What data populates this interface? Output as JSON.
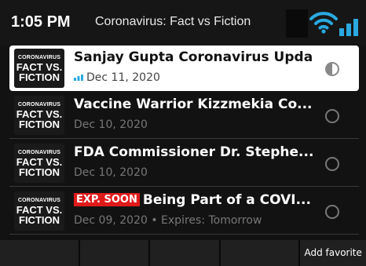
{
  "status_bar": {
    "time": "1:05 PM",
    "title": "Coronavirus: Fact vs Fiction",
    "icons": [
      "wifi-icon",
      "signal-icon"
    ]
  },
  "thumbnail": {
    "small": "CORONAVIRUS",
    "line1": "FACT VS.",
    "line2": "FICTION"
  },
  "episodes": [
    {
      "title": "Sanjay Gupta Coronavirus Upda",
      "date": "Dec 11, 2020",
      "status": "partially-played",
      "selected": true
    },
    {
      "title": "Vaccine Warrior Kizzmekia Co...",
      "date": "Dec 10, 2020",
      "status": "unplayed"
    },
    {
      "title": "FDA Commissioner Dr. Stephe...",
      "date": "Dec 10, 2020",
      "status": "unplayed"
    },
    {
      "title": "Being Part of a COVI...",
      "date": "Dec 09, 2020",
      "badge": "EXP. SOON",
      "expires": "• Expires: Tomorrow",
      "status": "unplayed"
    }
  ],
  "softkeys": [
    "",
    "",
    "",
    "",
    "Add favorite"
  ],
  "colors": {
    "badge": "#e01a1a",
    "wifi": "#2aa8e0",
    "signal": "#2aa8e0",
    "selected_bg": "#ffffff"
  }
}
